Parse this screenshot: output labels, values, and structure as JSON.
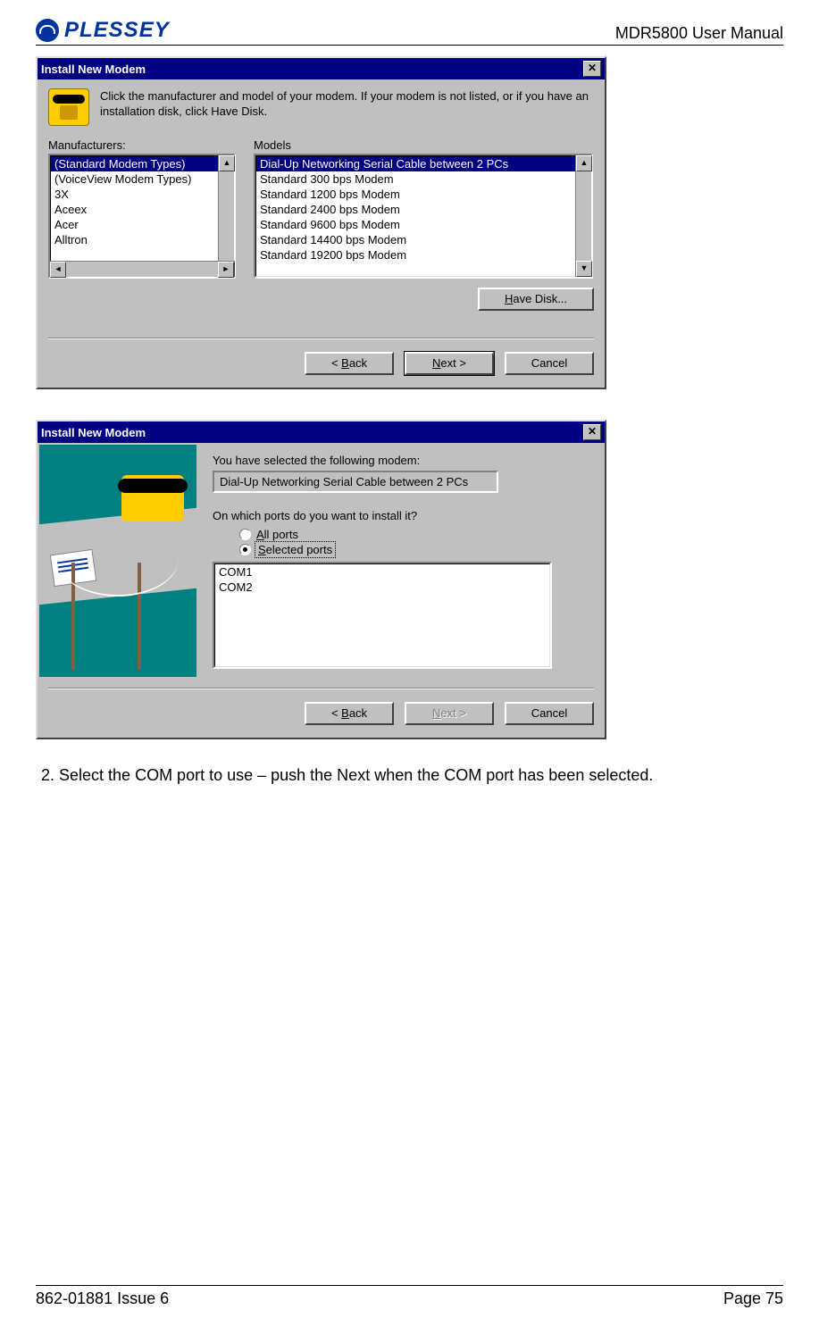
{
  "header": {
    "logo_text": "PLESSEY",
    "manual_title": "MDR5800 User Manual"
  },
  "footer": {
    "left": "862-01881 Issue 6",
    "right": "Page 75"
  },
  "body_text": {
    "step2": "2.   Select the COM port to use – push the Next when the COM port has been selected."
  },
  "dialog1": {
    "title": "Install New Modem",
    "close": "✕",
    "instruction": "Click the manufacturer and model of your modem. If your modem is not listed, or if you have an installation disk, click Have Disk.",
    "mfg_label": "Manufacturers:",
    "mdl_label": "Models",
    "manufacturers": [
      "(Standard Modem Types)",
      "(VoiceView Modem Types)",
      "3X",
      "Aceex",
      "Acer",
      "Alltron"
    ],
    "models": [
      "Dial-Up Networking Serial Cable between 2 PCs",
      "Standard    300 bps Modem",
      "Standard  1200 bps Modem",
      "Standard  2400 bps Modem",
      "Standard  9600 bps Modem",
      "Standard 14400 bps Modem",
      "Standard 19200 bps Modem"
    ],
    "have_disk_pre": "H",
    "have_disk_post": "ave Disk...",
    "back_pre": "< ",
    "back_u": "B",
    "back_post": "ack",
    "next_u": "N",
    "next_post": "ext >",
    "cancel": "Cancel"
  },
  "dialog2": {
    "title": "Install New Modem",
    "close": "✕",
    "selected_label": "You have selected the following modem:",
    "selected_value": "Dial-Up Networking Serial Cable between 2 PCs",
    "ports_question": "On which ports do you want to install it?",
    "all_ports_u": "A",
    "all_ports_post": "ll ports",
    "selected_ports_u": "S",
    "selected_ports_post": "elected ports",
    "ports": [
      "COM1",
      "COM2"
    ],
    "back_pre": "< ",
    "back_u": "B",
    "back_post": "ack",
    "next_u": "N",
    "next_post": "ext >",
    "cancel": "Cancel"
  }
}
